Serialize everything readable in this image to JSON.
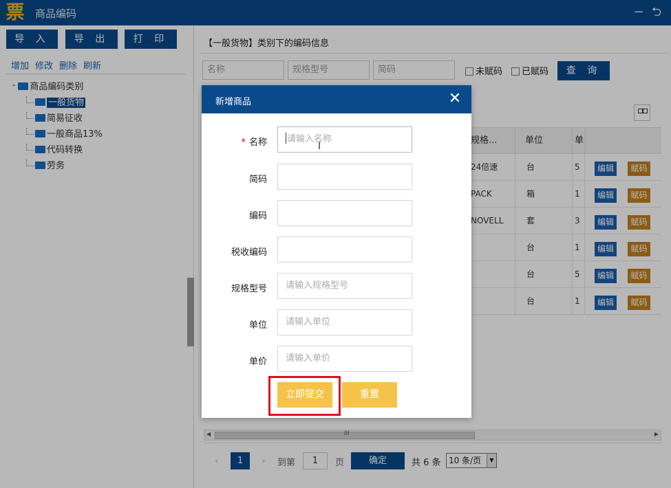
{
  "app": {
    "logo_char": "票",
    "title": "商品编码",
    "minimize_glyph": "−",
    "restore_glyph": "⮌"
  },
  "sidebar": {
    "toolbar": {
      "import_label": "导 入",
      "export_label": "导 出",
      "print_label": "打 印"
    },
    "links": {
      "add": "增加",
      "edit": "修改",
      "delete": "删除",
      "refresh": "刷新"
    },
    "tree": {
      "root": "商品编码类别",
      "children": [
        {
          "label": "一般货物",
          "selected": true
        },
        {
          "label": "简易征收"
        },
        {
          "label": "一般商品13%"
        },
        {
          "label": "代码转换"
        },
        {
          "label": "劳务"
        }
      ]
    }
  },
  "main": {
    "heading": "【一般货物】类别下的编码信息",
    "filters": {
      "name_placeholder": "名称",
      "spec_placeholder": "规格型号",
      "short_code_placeholder": "简码",
      "unassigned_label": "未赋码",
      "assigned_label": "已赋码",
      "query_label": "查 询"
    },
    "table": {
      "headers": [
        "规格...",
        "单位",
        "单"
      ],
      "rows": [
        {
          "spec": "24倍速",
          "unit": "台",
          "price_frag": "5"
        },
        {
          "spec": "PACK",
          "unit": "箱",
          "price_frag": "1"
        },
        {
          "spec": "NOVELL",
          "unit": "套",
          "price_frag": "3"
        },
        {
          "spec": "",
          "unit": "台",
          "price_frag": "1"
        },
        {
          "spec": "",
          "unit": "台",
          "price_frag": "5"
        },
        {
          "spec": "",
          "unit": "台",
          "price_frag": "1"
        }
      ],
      "edit_label": "编辑",
      "assign_label": "赋码"
    },
    "scroll_grip": "III",
    "pager": {
      "prev": "‹",
      "current_page": "1",
      "next": "›",
      "goto_label": "到第",
      "goto_value": "1",
      "page_unit": "页",
      "confirm_label": "确定",
      "total_text": "共 6 条",
      "page_size": "10 条/页"
    }
  },
  "modal": {
    "title": "新增商品",
    "close_glyph": "✕",
    "fields": {
      "name": {
        "label": "名称",
        "required_mark": "*",
        "placeholder": "请输入名称"
      },
      "short_code": {
        "label": "简码"
      },
      "code": {
        "label": "编码"
      },
      "tax_code": {
        "label": "税收编码"
      },
      "spec": {
        "label": "规格型号",
        "placeholder": "请输入规格型号"
      },
      "unit": {
        "label": "单位",
        "placeholder": "请输入单位"
      },
      "price": {
        "label": "单价",
        "placeholder": "请输入单价"
      }
    },
    "submit_label": "立即提交",
    "reset_label": "重置"
  }
}
